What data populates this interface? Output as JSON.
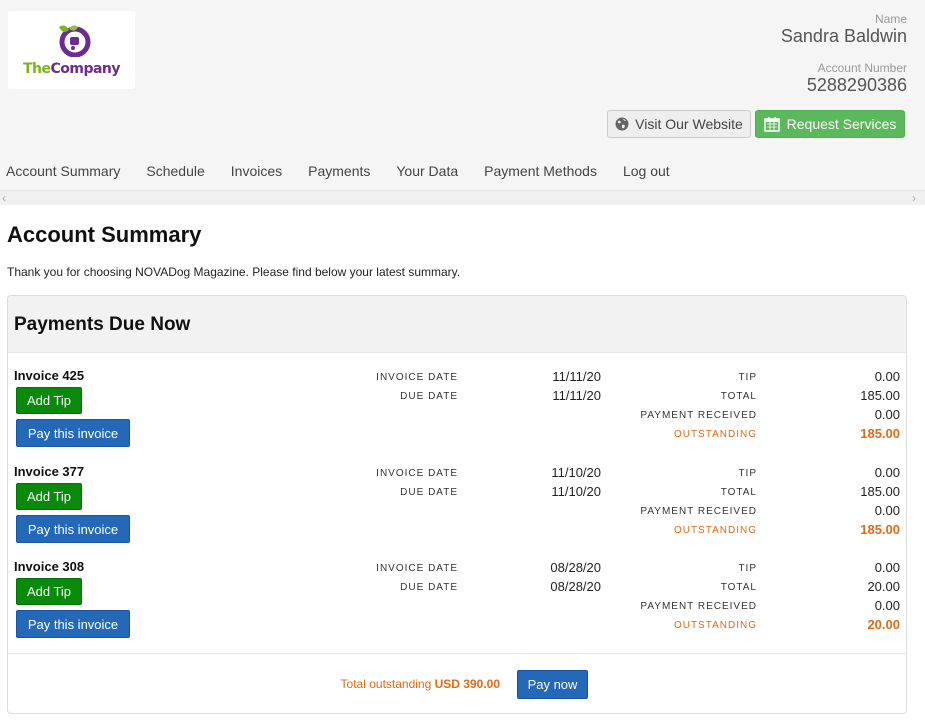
{
  "brand": {
    "logo_the": "The",
    "logo_company": "Company",
    "colors": {
      "green": "#7ab51d",
      "purple": "#6b2c8f"
    }
  },
  "account": {
    "name_label": "Name",
    "name": "Sandra Baldwin",
    "number_label": "Account Number",
    "number": "5288290386"
  },
  "actions": {
    "visit_label": "Visit Our Website",
    "visit_icon": "globe-icon",
    "request_label": "Request Services",
    "request_icon": "calendar-icon"
  },
  "nav": [
    {
      "label": "Account Summary"
    },
    {
      "label": "Schedule"
    },
    {
      "label": "Invoices"
    },
    {
      "label": "Payments"
    },
    {
      "label": "Your Data"
    },
    {
      "label": "Payment Methods"
    },
    {
      "label": "Log out"
    }
  ],
  "page": {
    "title": "Account Summary",
    "intro": "Thank you for choosing NOVADog Magazine. Please find below your latest summary."
  },
  "panel": {
    "title": "Payments Due Now",
    "add_tip_label": "Add Tip",
    "pay_invoice_label": "Pay this invoice",
    "captions": {
      "invoice_date": "INVOICE DATE",
      "due_date": "DUE DATE",
      "tip": "TIP",
      "total": "TOTAL",
      "payment_received": "PAYMENT RECEIVED",
      "outstanding": "OUTSTANDING"
    },
    "invoices": [
      {
        "title": "Invoice 425",
        "invoice_date": "11/11/20",
        "due_date": "11/11/20",
        "tip": "0.00",
        "total": "185.00",
        "payment_received": "0.00",
        "outstanding": "185.00"
      },
      {
        "title": "Invoice 377",
        "invoice_date": "11/10/20",
        "due_date": "11/10/20",
        "tip": "0.00",
        "total": "185.00",
        "payment_received": "0.00",
        "outstanding": "185.00"
      },
      {
        "title": "Invoice 308",
        "invoice_date": "08/28/20",
        "due_date": "08/28/20",
        "tip": "0.00",
        "total": "20.00",
        "payment_received": "0.00",
        "outstanding": "20.00"
      }
    ],
    "total_label": "Total outstanding",
    "total_amount": "USD 390.00",
    "pay_now_label": "Pay now"
  }
}
